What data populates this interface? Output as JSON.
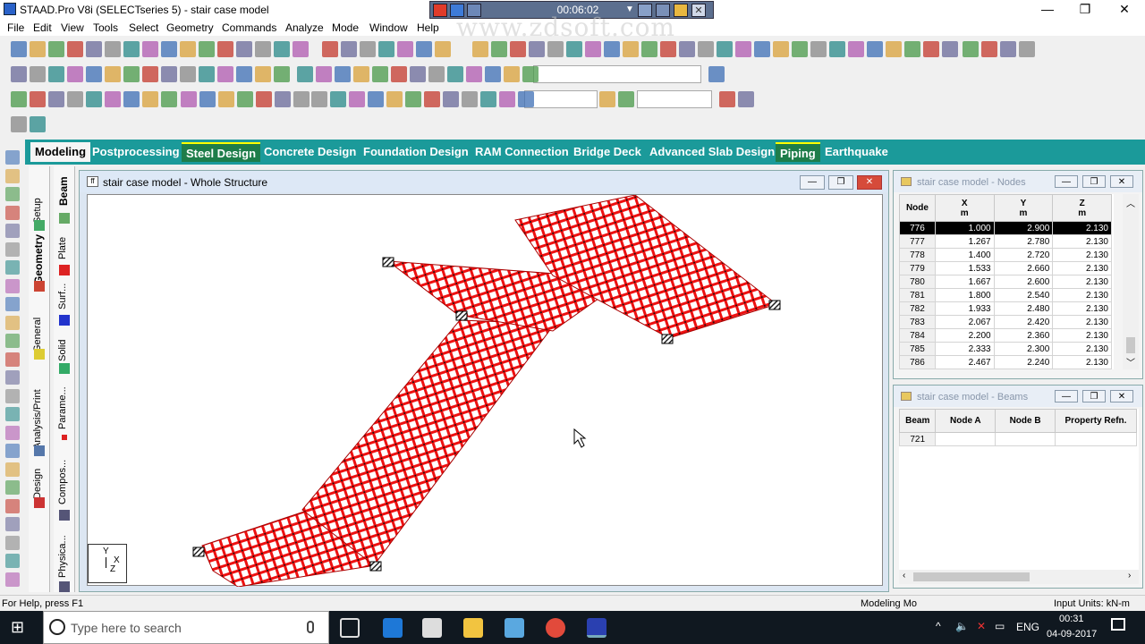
{
  "window": {
    "title": "STAAD.Pro V8i (SELECTseries 5) - stair case model",
    "controls": {
      "minimize": "—",
      "maximize": "❐",
      "close": "✕"
    }
  },
  "recorder": {
    "time": "00:06:02"
  },
  "watermark": "www.zdsoft.com",
  "menu": [
    "File",
    "Edit",
    "View",
    "Tools",
    "Select",
    "Geometry",
    "Commands",
    "Analyze",
    "Mode",
    "Window",
    "Help"
  ],
  "page_tabs": [
    {
      "label": "Modeling",
      "state": "active"
    },
    {
      "label": "Postprocessing",
      "state": "normal"
    },
    {
      "label": "Steel Design",
      "state": "highlight"
    },
    {
      "label": "Concrete Design",
      "state": "normal"
    },
    {
      "label": "Foundation Design",
      "state": "normal"
    },
    {
      "label": "RAM Connection",
      "state": "normal"
    },
    {
      "label": "Bridge Deck",
      "state": "normal"
    },
    {
      "label": "Advanced Slab Design",
      "state": "normal"
    },
    {
      "label": "Piping",
      "state": "highlight"
    },
    {
      "label": "Earthquake",
      "state": "normal"
    }
  ],
  "side_tabs_left": [
    "Setup",
    "Geometry",
    "General",
    "Analysis/Print",
    "Design"
  ],
  "side_tabs_right": [
    "Beam",
    "Plate",
    "Surf...",
    "Solid",
    "Parame...",
    "Compos...",
    "Physica..."
  ],
  "main_window": {
    "title": "stair case model - Whole Structure"
  },
  "axis": {
    "y": "Y",
    "x": "X",
    "z": "Z"
  },
  "nodes_window": {
    "title": "stair case model - Nodes",
    "columns": [
      {
        "name": "Node",
        "unit": ""
      },
      {
        "name": "X",
        "unit": "m"
      },
      {
        "name": "Y",
        "unit": "m"
      },
      {
        "name": "Z",
        "unit": "m"
      }
    ],
    "rows": [
      [
        "776",
        "1.000",
        "2.900",
        "2.130"
      ],
      [
        "777",
        "1.267",
        "2.780",
        "2.130"
      ],
      [
        "778",
        "1.400",
        "2.720",
        "2.130"
      ],
      [
        "779",
        "1.533",
        "2.660",
        "2.130"
      ],
      [
        "780",
        "1.667",
        "2.600",
        "2.130"
      ],
      [
        "781",
        "1.800",
        "2.540",
        "2.130"
      ],
      [
        "782",
        "1.933",
        "2.480",
        "2.130"
      ],
      [
        "783",
        "2.067",
        "2.420",
        "2.130"
      ],
      [
        "784",
        "2.200",
        "2.360",
        "2.130"
      ],
      [
        "785",
        "2.333",
        "2.300",
        "2.130"
      ],
      [
        "786",
        "2.467",
        "2.240",
        "2.130"
      ]
    ],
    "selected_row": 0
  },
  "beams_window": {
    "title": "stair case model - Beams",
    "columns": [
      "Beam",
      "Node A",
      "Node B",
      "Property Refn."
    ],
    "rows": [
      [
        "721",
        "",
        "",
        ""
      ]
    ]
  },
  "status": {
    "help": "For Help, press F1",
    "mode": "Modeling Mo",
    "units": "Input Units:  kN-m"
  },
  "taskbar": {
    "search_placeholder": "Type here to search",
    "lang": "ENG",
    "time": "00:31",
    "date": "04-09-2017"
  },
  "colors": {
    "accent_tab": "#1b9a9a",
    "mesh": "#ee1111",
    "selection": "#000000"
  }
}
